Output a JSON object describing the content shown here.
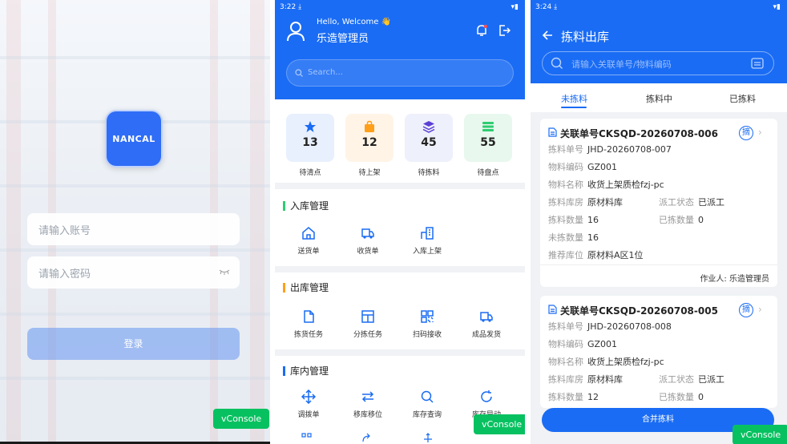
{
  "login": {
    "logo_text": "NANCAL",
    "account_placeholder": "请输入账号",
    "password_placeholder": "请输入密码",
    "login_button": "登录",
    "vconsole": "vConsole"
  },
  "home": {
    "status_time": "3:22",
    "greeting": "Hello, Welcome 👋",
    "username": "乐造管理员",
    "search_placeholder": "Search...",
    "stats": [
      {
        "value": "13",
        "label": "待清点",
        "icon": "star-icon",
        "color": "#1a6cf4"
      },
      {
        "value": "12",
        "label": "待上架",
        "icon": "bag-icon",
        "color": "#ff9f1a"
      },
      {
        "value": "45",
        "label": "待拣料",
        "icon": "layers-icon",
        "color": "#5b3fd6"
      },
      {
        "value": "55",
        "label": "待盘点",
        "icon": "list-icon",
        "color": "#2ecc71"
      }
    ],
    "sections": [
      {
        "title": "入库管理",
        "items": [
          "送货单",
          "收货单",
          "入库上架"
        ]
      },
      {
        "title": "出库管理",
        "items": [
          "拣货任务",
          "分拣任务",
          "扫码接收",
          "成品发货"
        ]
      },
      {
        "title": "库内管理",
        "items": [
          "调拨单",
          "移库移位",
          "库存查询",
          "库存异动"
        ]
      }
    ],
    "vconsole": "vConsole"
  },
  "picking": {
    "status_time": "3:24",
    "title": "拣料出库",
    "search_placeholder": "请输入关联单号/物料编码",
    "tabs": [
      "未拣料",
      "拣料中",
      "已拣料"
    ],
    "labels": {
      "pick_no": "拣料单号",
      "material_code": "物料编码",
      "material_name": "物料名称",
      "warehouse": "拣料库房",
      "dispatch_status": "派工状态",
      "quantity": "拣料数量",
      "picked_qty": "已拣数量",
      "unpicked_qty": "未拣数量",
      "location": "推荐库位"
    },
    "cards": [
      {
        "ref_no": "关联单号CKSQD-20260708-006",
        "badge": "摘",
        "pick_no": "JHD-20260708-007",
        "material_code": "GZ001",
        "material_name": "收货上架质检fzj-pc",
        "warehouse": "原材料库",
        "dispatch_status": "已派工",
        "quantity": "16",
        "picked_qty": "0",
        "unpicked_qty": "16",
        "location": "原材料A区1位",
        "operator": "作业人: 乐造管理员"
      },
      {
        "ref_no": "关联单号CKSQD-20260708-005",
        "badge": "摘",
        "pick_no": "JHD-20260708-008",
        "material_code": "GZ001",
        "material_name": "收货上架质检fzj-pc",
        "warehouse": "原材料库",
        "dispatch_status": "已派工",
        "quantity": "12",
        "picked_qty": "0"
      }
    ],
    "merge_button": "合并拣料",
    "vconsole": "vConsole"
  }
}
